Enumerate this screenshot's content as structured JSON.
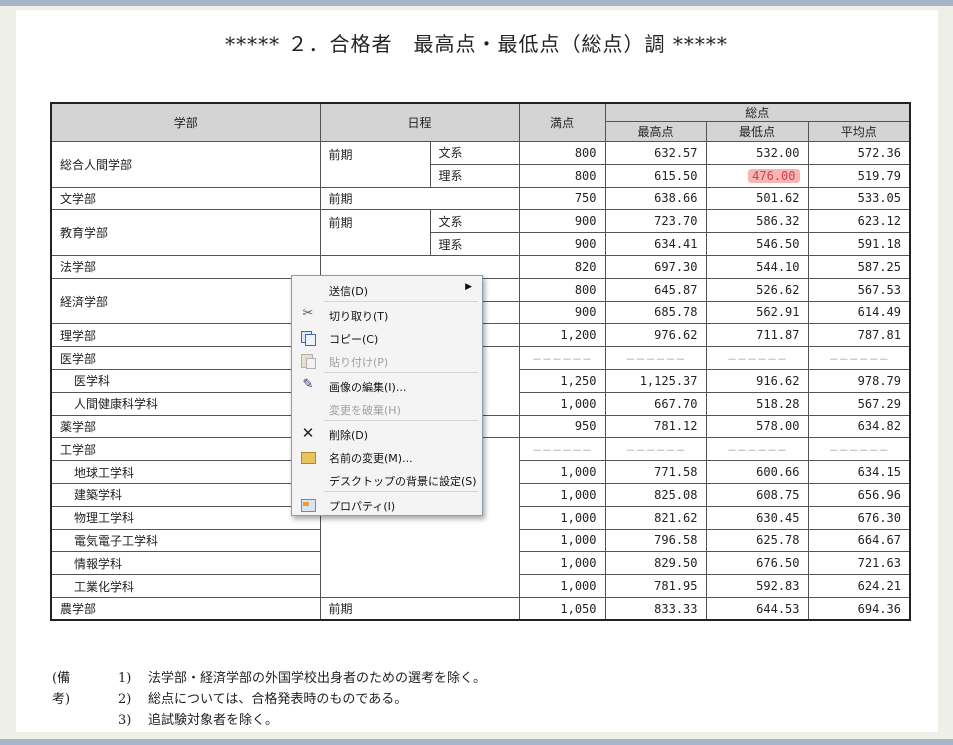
{
  "title": "***** ２．合格者　最高点・最低点（総点）調 *****",
  "table": {
    "headers": {
      "faculty": "学部",
      "schedule": "日程",
      "full_score": "満点",
      "total": "総点",
      "max": "最高点",
      "min": "最低点",
      "avg": "平均点"
    },
    "rows": [
      {
        "faculty": "総合人間学部",
        "schedule": "前期",
        "type": "文系",
        "full": "800",
        "max": "632.57",
        "min": "532.00",
        "avg": "572.36"
      },
      {
        "faculty": "",
        "schedule": "",
        "type": "理系",
        "full": "800",
        "max": "615.50",
        "min": "476.00",
        "avg": "519.79"
      },
      {
        "faculty": "文学部",
        "schedule": "前期",
        "type": "",
        "full": "750",
        "max": "638.66",
        "min": "501.62",
        "avg": "533.05"
      },
      {
        "faculty": "教育学部",
        "schedule": "前期",
        "type": "文系",
        "full": "900",
        "max": "723.70",
        "min": "586.32",
        "avg": "623.12"
      },
      {
        "faculty": "",
        "schedule": "",
        "type": "理系",
        "full": "900",
        "max": "634.41",
        "min": "546.50",
        "avg": "591.18"
      },
      {
        "faculty": "法学部",
        "schedule": "",
        "type": "",
        "full": "820",
        "max": "697.30",
        "min": "544.10",
        "avg": "587.25"
      },
      {
        "faculty": "経済学部",
        "schedule": "",
        "type": "",
        "full": "800",
        "max": "645.87",
        "min": "526.62",
        "avg": "567.53"
      },
      {
        "faculty": "",
        "schedule": "",
        "type": "",
        "full": "900",
        "max": "685.78",
        "min": "562.91",
        "avg": "614.49"
      },
      {
        "faculty": "理学部",
        "schedule": "",
        "type": "",
        "full": "1,200",
        "max": "976.62",
        "min": "711.87",
        "avg": "787.81"
      },
      {
        "faculty": "医学部",
        "schedule": "",
        "type": "",
        "full": "",
        "max": "",
        "min": "",
        "avg": ""
      },
      {
        "faculty": "医学科",
        "schedule": "",
        "type": "",
        "full": "1,250",
        "max": "1,125.37",
        "min": "916.62",
        "avg": "978.79"
      },
      {
        "faculty": "人間健康科学科",
        "schedule": "",
        "type": "",
        "full": "1,000",
        "max": "667.70",
        "min": "518.28",
        "avg": "567.29"
      },
      {
        "faculty": "薬学部",
        "schedule": "",
        "type": "",
        "full": "950",
        "max": "781.12",
        "min": "578.00",
        "avg": "634.82"
      },
      {
        "faculty": "工学部",
        "schedule": "",
        "type": "",
        "full": "",
        "max": "",
        "min": "",
        "avg": ""
      },
      {
        "faculty": "地球工学科",
        "schedule": "",
        "type": "",
        "full": "1,000",
        "max": "771.58",
        "min": "600.66",
        "avg": "634.15"
      },
      {
        "faculty": "建築学科",
        "schedule": "",
        "type": "",
        "full": "1,000",
        "max": "825.08",
        "min": "608.75",
        "avg": "656.96"
      },
      {
        "faculty": "物理工学科",
        "schedule": "",
        "type": "",
        "full": "1,000",
        "max": "821.62",
        "min": "630.45",
        "avg": "676.30"
      },
      {
        "faculty": "電気電子工学科",
        "schedule": "",
        "type": "",
        "full": "1,000",
        "max": "796.58",
        "min": "625.78",
        "avg": "664.67"
      },
      {
        "faculty": "情報学科",
        "schedule": "",
        "type": "",
        "full": "1,000",
        "max": "829.50",
        "min": "676.50",
        "avg": "721.63"
      },
      {
        "faculty": "工業化学科",
        "schedule": "",
        "type": "",
        "full": "1,000",
        "max": "781.95",
        "min": "592.83",
        "avg": "624.21"
      },
      {
        "faculty": "農学部",
        "schedule": "前期",
        "type": "",
        "full": "1,050",
        "max": "833.33",
        "min": "644.53",
        "avg": "694.36"
      }
    ],
    "dash": "－－－－－－"
  },
  "notes": {
    "label": "(備考)",
    "items": [
      {
        "num": "1)",
        "text": "法学部・経済学部の外国学校出身者のための選考を除く。"
      },
      {
        "num": "2)",
        "text": "総点については、合格発表時のものである。"
      },
      {
        "num": "3)",
        "text": "追試験対象者を除く。"
      }
    ]
  },
  "context_menu": {
    "items": [
      {
        "label": "送信(D)",
        "icon": "",
        "enabled": true,
        "submenu": true
      },
      {
        "label": "切り取り(T)",
        "icon": "scissors-icon",
        "enabled": true
      },
      {
        "label": "コピー(C)",
        "icon": "copy-icon",
        "enabled": true
      },
      {
        "label": "貼り付け(P)",
        "icon": "paste-icon",
        "enabled": false
      },
      {
        "label": "画像の編集(I)...",
        "icon": "edit-image-icon",
        "enabled": true
      },
      {
        "label": "変更を破棄(H)",
        "icon": "",
        "enabled": false
      },
      {
        "label": "削除(D)",
        "icon": "delete-x-icon",
        "enabled": true
      },
      {
        "label": "名前の変更(M)...",
        "icon": "rename-icon",
        "enabled": true
      },
      {
        "label": "デスクトップの背景に設定(S)",
        "icon": "",
        "enabled": true
      },
      {
        "label": "プロパティ(I)",
        "icon": "properties-icon",
        "enabled": true
      }
    ]
  },
  "colors": {
    "highlight": "#f7b6b6",
    "header_bg": "#d4d4d4"
  }
}
